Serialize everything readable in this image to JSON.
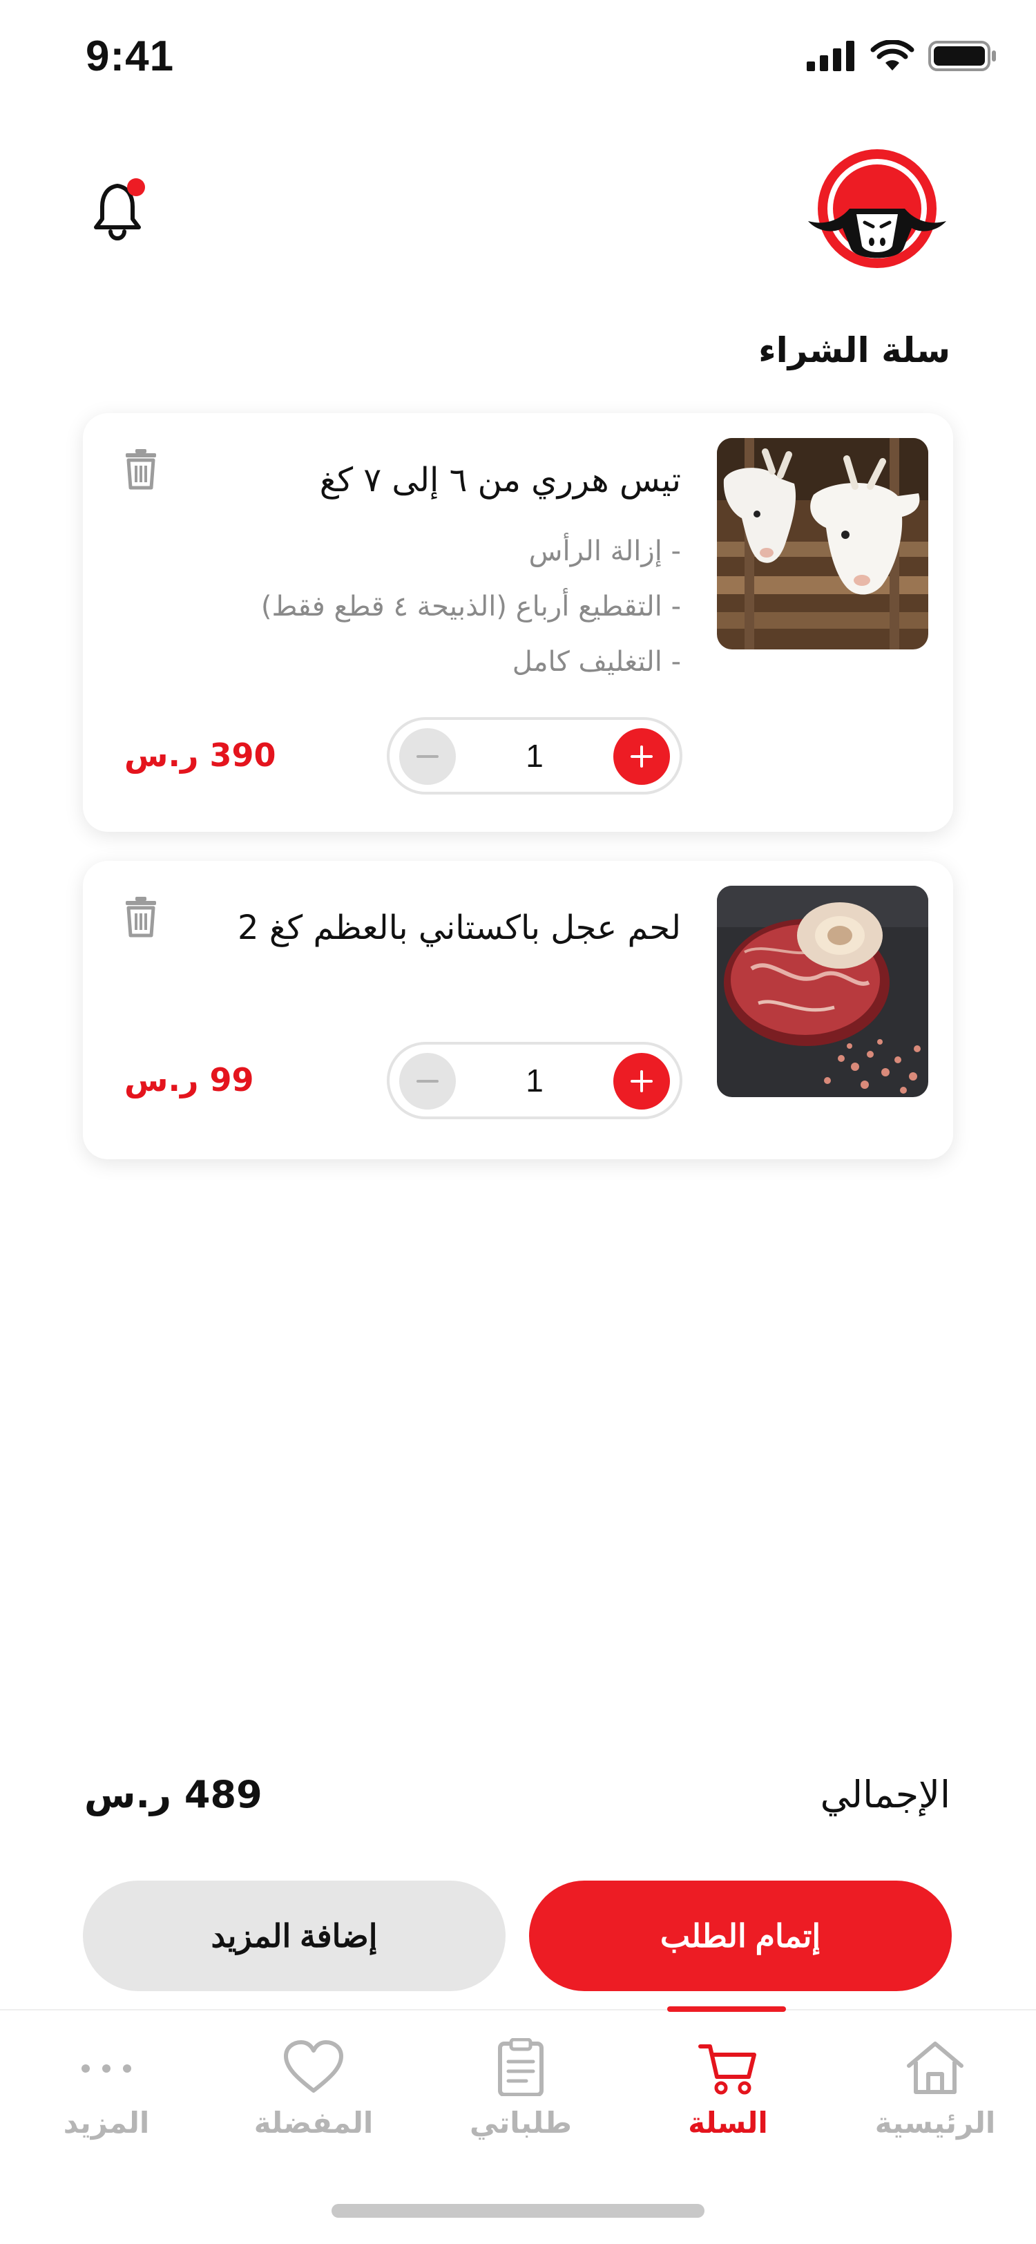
{
  "status": {
    "time": "9:41"
  },
  "page": {
    "title": "سلة الشراء"
  },
  "cart": {
    "items": [
      {
        "name": "تيس هرري من ٦ إلى ٧ كغ",
        "options": [
          "- إزالة الرأس",
          "- التقطيع أرباع (الذبيحة ٤ قطع فقط)",
          "- التغليف كامل"
        ],
        "quantity": "1",
        "price": "390 ر.س",
        "image": "goats-photo"
      },
      {
        "name": "لحم عجل باكستاني بالعظم كغ 2",
        "options": [],
        "quantity": "1",
        "price": "99 ر.س",
        "image": "beef-shank-photo"
      }
    ]
  },
  "summary": {
    "total_label": "الإجمالي",
    "total_value": "489 ر.س"
  },
  "actions": {
    "checkout_label": "إتمام الطلب",
    "add_more_label": "إضافة المزيد"
  },
  "tabbar": {
    "active": "cart",
    "tabs": [
      {
        "key": "home",
        "label": "الرئيسية",
        "icon": "home-icon"
      },
      {
        "key": "cart",
        "label": "السلة",
        "icon": "cart-icon"
      },
      {
        "key": "orders",
        "label": "طلباتي",
        "icon": "clipboard-icon"
      },
      {
        "key": "favorites",
        "label": "المفضلة",
        "icon": "heart-icon"
      },
      {
        "key": "more",
        "label": "المزيد",
        "icon": "more-dots-icon"
      }
    ]
  },
  "colors": {
    "accent": "#ED1C24",
    "muted": "#B5B5B5",
    "option_text": "#8A8A8A"
  }
}
